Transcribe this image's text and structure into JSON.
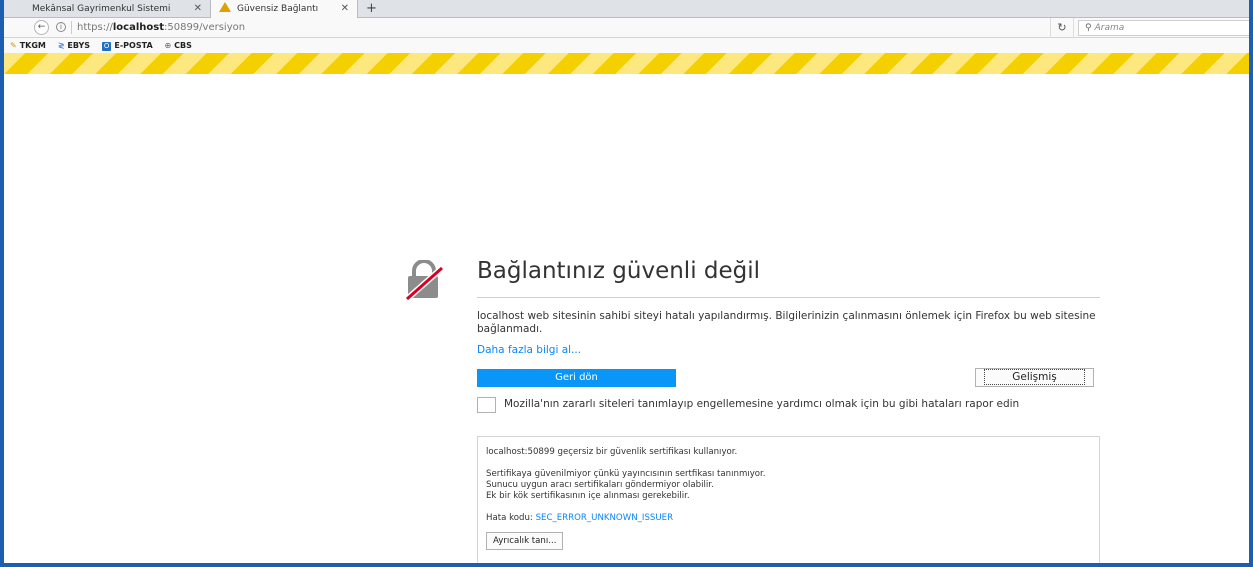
{
  "tabs": [
    {
      "label": "Mekânsal Gayrimenkul Sistemi",
      "close": "✕"
    },
    {
      "label": "Güvensiz Bağlantı",
      "close": "✕"
    }
  ],
  "new_tab": "+",
  "nav": {
    "url_prefix": "https://",
    "url_host": "localhost",
    "url_rest": ":50899/versiyon",
    "search_placeholder": "Arama"
  },
  "bookmarks": [
    "TKGM",
    "EBYS",
    "E-POSTA",
    "CBS"
  ],
  "error": {
    "title": "Bağlantınız güvenli değil",
    "description": "localhost web sitesinin sahibi siteyi hatalı yapılandırmış. Bilgilerinizin çalınmasını önlemek için Firefox bu web sitesine bağlanmadı.",
    "more_link": "Daha fazla bilgi al...",
    "back_button": "Geri dön",
    "advanced_button": "Gelişmiş",
    "report_label": "Mozilla'nın zararlı siteleri tanımlayıp engellemesine yardımcı olmak için bu gibi hataları rapor edin"
  },
  "advanced": {
    "line1": "localhost:50899 geçersiz bir güvenlik sertifikası kullanıyor.",
    "line2": "Sertifikaya güvenilmiyor çünkü yayıncısının sertfikası tanınmıyor.",
    "line3": "Sunucu uygun aracı sertifikaları göndermiyor olabilir.",
    "line4": "Ek bir kök sertifikasının içe alınması gerekebilir.",
    "code_label": "Hata kodu:",
    "code_value": "SEC_ERROR_UNKNOWN_ISSUER",
    "exception_button": "Ayrıcalık tanı..."
  }
}
